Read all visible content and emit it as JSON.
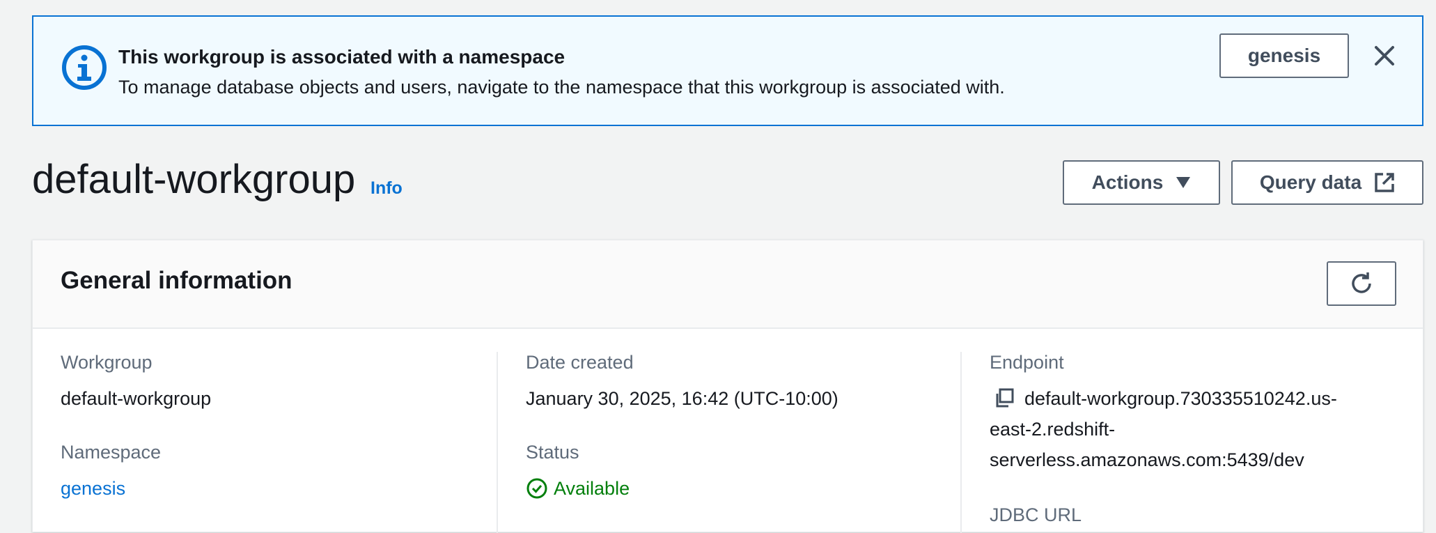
{
  "flash": {
    "title": "This workgroup is associated with a namespace",
    "description": "To manage database objects and users, navigate to the namespace that this workgroup is associated with.",
    "button_label": "genesis"
  },
  "header": {
    "title": "default-workgroup",
    "info_label": "Info",
    "actions_label": "Actions",
    "query_label": "Query data"
  },
  "general": {
    "title": "General information",
    "workgroup_label": "Workgroup",
    "workgroup_value": "default-workgroup",
    "namespace_label": "Namespace",
    "namespace_value": "genesis",
    "date_label": "Date created",
    "date_value": "January 30, 2025, 16:42 (UTC-10:00)",
    "status_label": "Status",
    "status_value": "Available",
    "endpoint_label": "Endpoint",
    "endpoint_line1": "default-workgroup.730335510242.us-",
    "endpoint_line2": "east-2.redshift-",
    "endpoint_line3": "serverless.amazonaws.com:5439/dev",
    "jdbc_label": "JDBC URL"
  },
  "colors": {
    "info_blue": "#0972d3",
    "success_green": "#037f0c",
    "flash_bg": "#f1faff"
  }
}
